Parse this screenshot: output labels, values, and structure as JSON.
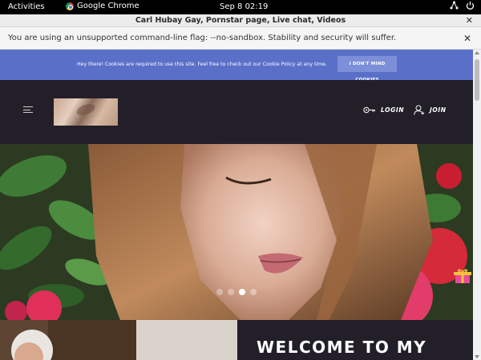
{
  "system_bar": {
    "activities": "Activities",
    "app_name": "Google Chrome",
    "clock": "Sep 8  02:19"
  },
  "window": {
    "title": "Carl Hubay Gay, Pornstar page, Live chat, Videos",
    "close_symbol": "✕"
  },
  "infobar": {
    "message": "You are using an unsupported command-line flag: --no-sandbox. Stability and security will suffer.",
    "close_symbol": "✕"
  },
  "cookie_banner": {
    "message": "Hey there! Cookies are required to use this site. Feel free to check out our Cookie Policy at any time.",
    "button_label": "I DON'T MIND COOKIES"
  },
  "header": {
    "login_label": "LOGIN",
    "join_label": "JOIN",
    "icons": [
      "menu-icon",
      "key-icon",
      "add-user-icon"
    ]
  },
  "hero": {
    "slides": 4,
    "active_slide": 3
  },
  "welcome": {
    "heading": "WELCOME TO MY"
  },
  "colors": {
    "page_bg": "#221f29",
    "cookie_bg": "#5a70c8",
    "cookie_button": "#7d8fd8"
  }
}
